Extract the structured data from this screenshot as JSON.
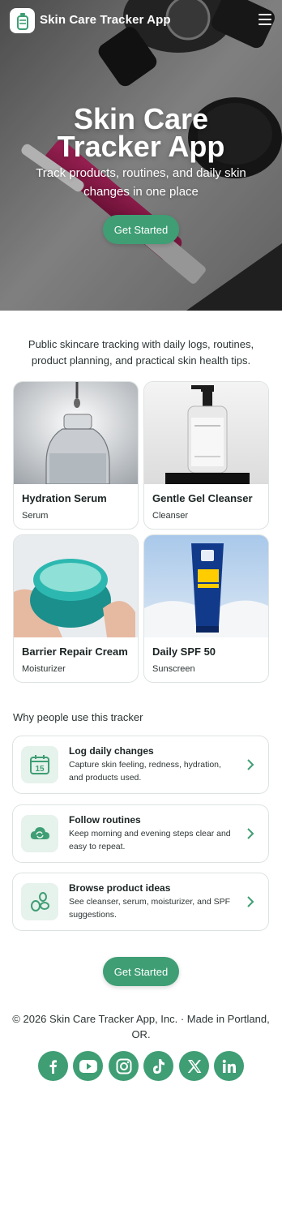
{
  "header": {
    "brand": "Skin Care Tracker App",
    "logo_icon": "bottle-icon",
    "menu_icon": "hamburger-menu-icon"
  },
  "hero": {
    "title_line1": "Skin Care",
    "title_line2": "Tracker App",
    "subtitle": "Track products, routines, and daily skin changes in one place",
    "cta_label": "Get Started"
  },
  "intro": {
    "text": "Public skincare tracking with daily logs, routines, product planning, and practical skin health tips."
  },
  "products": [
    {
      "name": "Hydration Serum",
      "category": "Serum"
    },
    {
      "name": "Gentle Gel Cleanser",
      "category": "Cleanser"
    },
    {
      "name": "Barrier Repair Cream",
      "category": "Moisturizer"
    },
    {
      "name": "Daily SPF 50",
      "category": "Sunscreen"
    }
  ],
  "why": {
    "title": "Why people use this tracker",
    "features": [
      {
        "title": "Log daily changes",
        "description": "Capture skin feeling, redness, hydration, and products used.",
        "icon": "calendar-icon",
        "calendar_day": "15"
      },
      {
        "title": "Follow routines",
        "description": "Keep morning and evening steps clear and easy to repeat.",
        "icon": "cloud-sync-icon"
      },
      {
        "title": "Browse product ideas",
        "description": "See cleanser, serum, moisturizer, and SPF suggestions.",
        "icon": "leaves-icon"
      }
    ]
  },
  "cta": {
    "label": "Get Started"
  },
  "footer": {
    "text": "© 2026 Skin Care Tracker App, Inc. · Made in Portland, OR.",
    "socials": [
      "facebook-icon",
      "youtube-icon",
      "instagram-icon",
      "tiktok-icon",
      "x-icon",
      "linkedin-icon"
    ]
  },
  "colors": {
    "accent": "#3f9e74",
    "icon_bg": "#e6f2ec",
    "card_border": "#dde3e1"
  }
}
